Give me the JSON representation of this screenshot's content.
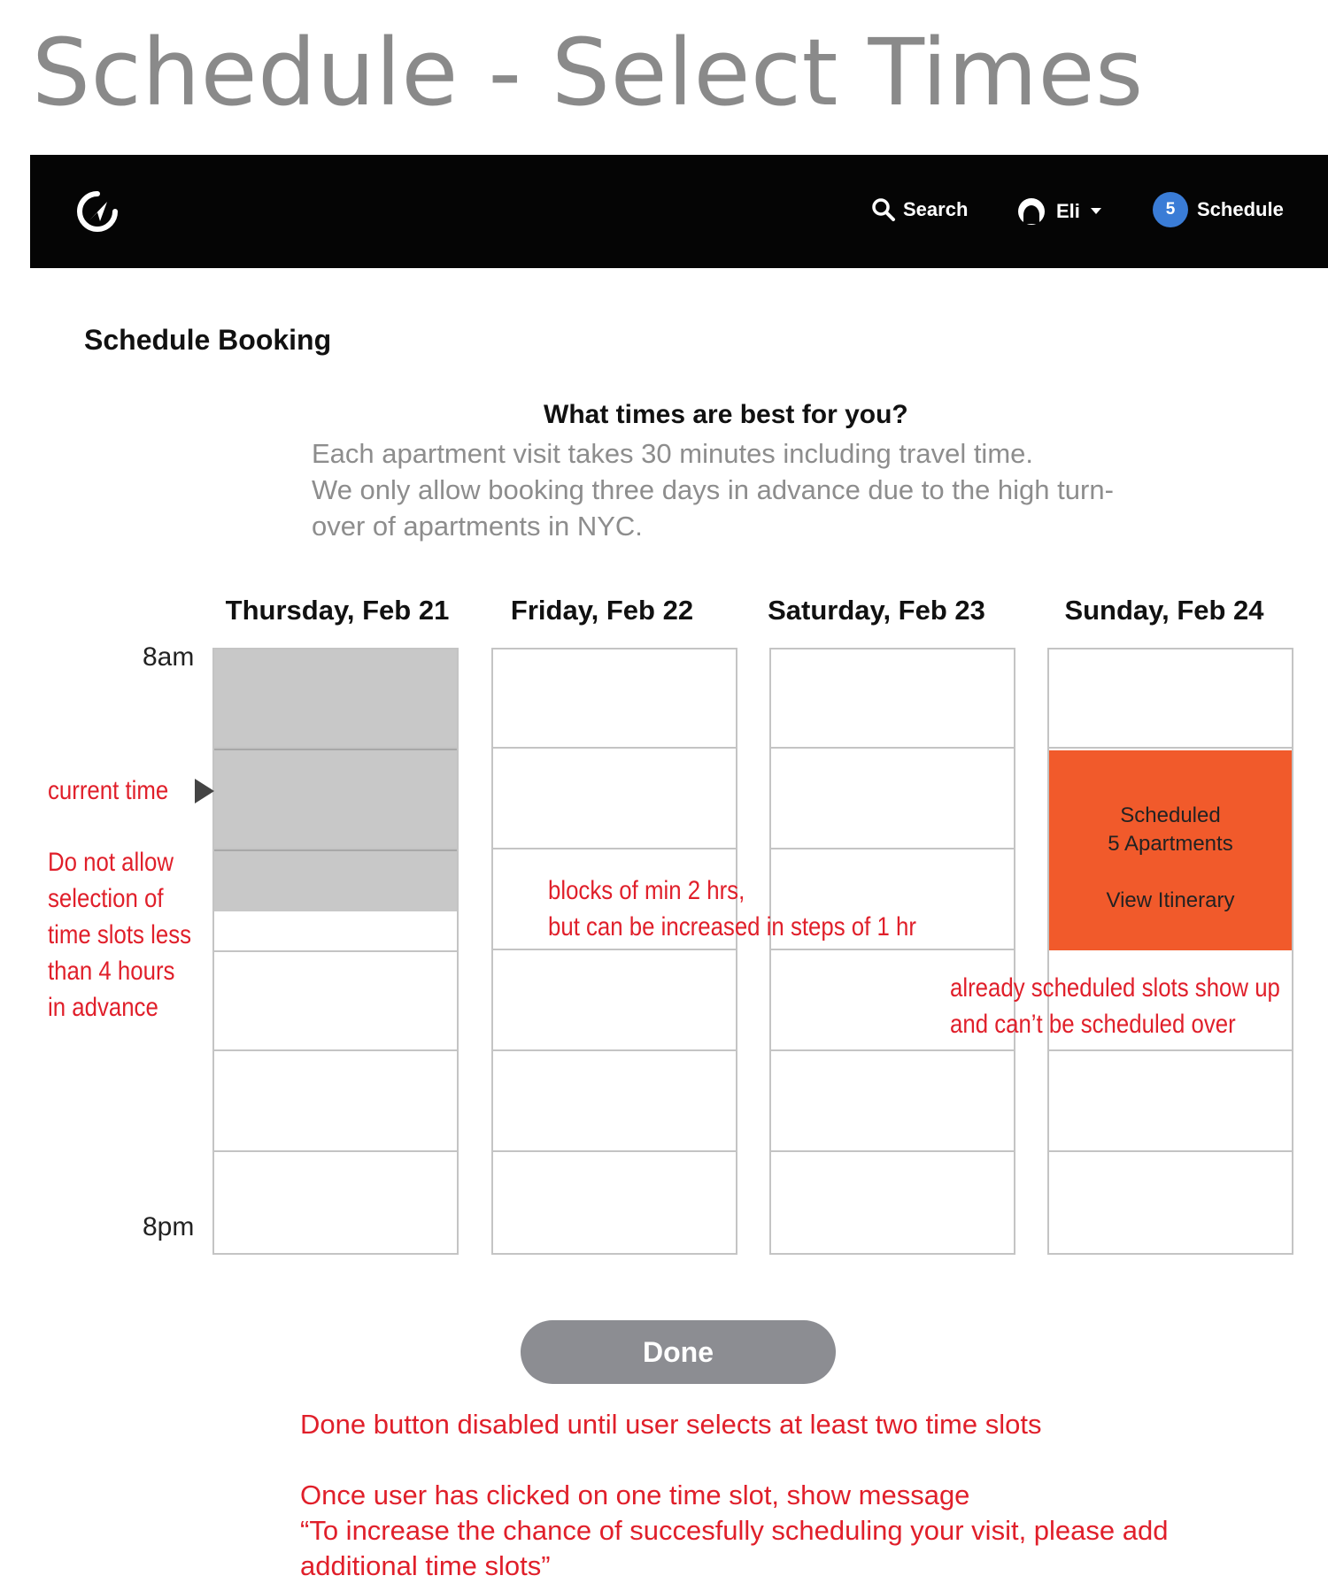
{
  "page_heading": "Schedule - Select Times",
  "navbar": {
    "search_label": "Search",
    "user_name": "Eli",
    "schedule_count": "5",
    "schedule_label": "Schedule"
  },
  "section_title": "Schedule Booking",
  "question": "What times are best for you?",
  "intro_lines": [
    "Each apartment visit takes 30 minutes including travel time.",
    "We only allow booking three days in advance due to the high turn-",
    "over of apartments in NYC."
  ],
  "days": [
    {
      "label": "Thursday, Feb 21"
    },
    {
      "label": "Friday, Feb 22"
    },
    {
      "label": "Saturday, Feb 23"
    },
    {
      "label": "Sunday, Feb 24"
    }
  ],
  "time_labels": {
    "start": "8am",
    "end": "8pm"
  },
  "scheduled_block": {
    "line1": "Scheduled",
    "line2": "5 Apartments",
    "link": "View Itinerary"
  },
  "done_label": "Done",
  "annotations": {
    "current_time": "current time",
    "advance_notice": [
      "Do not allow",
      "selection of",
      "time slots less",
      "than 4 hours",
      "in advance"
    ],
    "block_size": [
      "blocks of min 2 hrs,",
      "but can be increased in steps of 1 hr"
    ],
    "already_scheduled": [
      "already scheduled slots show up",
      "and can’t be scheduled over"
    ],
    "done_disabled": "Done button disabled until user selects at least two time slots",
    "message": [
      "Once user has clicked on one time slot, show message",
      "“To increase the chance of succesfully scheduling your visit, please add",
      "additional time slots”"
    ]
  },
  "colors": {
    "navbar": "#050505",
    "badge": "#3a7cd6",
    "scheduled": "#f15a2b",
    "annotation": "#e01f2a",
    "past_slots": "#c8c8c8",
    "done_button": "#8c8d92"
  }
}
